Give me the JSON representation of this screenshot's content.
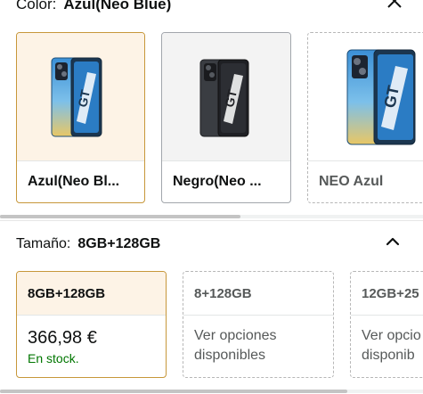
{
  "color_section": {
    "label": "Color:",
    "selected_value": "Azul(Neo Blue)",
    "swatches": [
      {
        "label": "Azul(Neo Bl...",
        "state": "selected"
      },
      {
        "label": "Negro(Neo ...",
        "state": "available"
      },
      {
        "label": "NEO Azul",
        "state": "unavailable"
      }
    ]
  },
  "size_section": {
    "label": "Tamaño:",
    "selected_value": "8GB+128GB",
    "options": [
      {
        "title": "8GB+128GB",
        "price": "366,98 €",
        "stock": "En stock.",
        "state": "selected"
      },
      {
        "title": "8+128GB",
        "note": "Ver opciones disponibles",
        "note_line1": "Ver opciones",
        "note_line2": "disponibles",
        "state": "unavailable"
      },
      {
        "title": "12GB+25",
        "note_line1": "Ver opcio",
        "note_line2": "disponib",
        "state": "unavailable"
      }
    ]
  },
  "colors": {
    "selected_border": "#c7973a",
    "selected_bg": "#fdf3e6",
    "in_stock": "#007600",
    "phone_blue": "#4aa3e0",
    "phone_gold": "#e9c765",
    "phone_black": "#2b2d31"
  },
  "icons": {
    "close": "close-icon",
    "collapse": "chevron-up-icon"
  }
}
